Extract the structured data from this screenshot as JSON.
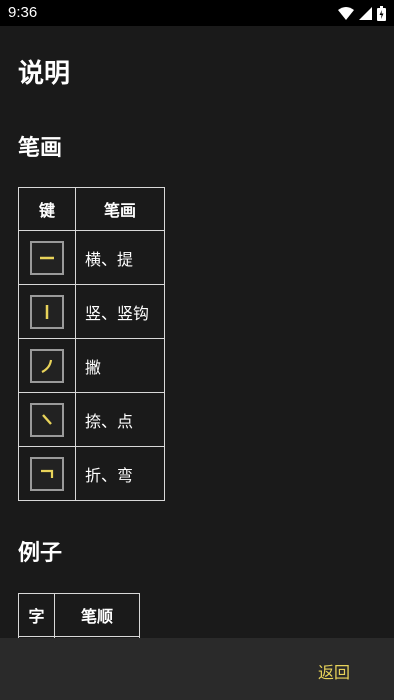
{
  "status_bar": {
    "time": "9:36",
    "icons": [
      "wifi-icon",
      "signal-icon",
      "battery-icon"
    ]
  },
  "page_title": "说明",
  "strokes_section": {
    "title": "笔画",
    "headers": {
      "key": "键",
      "stroke": "笔画"
    },
    "rows": [
      {
        "key_icon": "horizontal-stroke-icon",
        "label": "横、提"
      },
      {
        "key_icon": "vertical-stroke-icon",
        "label": "竖、竖钩"
      },
      {
        "key_icon": "left-falling-stroke-icon",
        "label": "撇"
      },
      {
        "key_icon": "dot-stroke-icon",
        "label": "捺、点"
      },
      {
        "key_icon": "turning-stroke-icon",
        "label": "折、弯"
      }
    ]
  },
  "examples_section": {
    "title": "例子",
    "headers": {
      "char": "字",
      "order": "笔顺"
    }
  },
  "bottom_bar": {
    "back_label": "返回"
  },
  "colors": {
    "background": "#1a1a1a",
    "key_stroke": "#e8d35a",
    "accent_text": "#e8d35a",
    "bottom_bar": "#2a2a2a"
  }
}
